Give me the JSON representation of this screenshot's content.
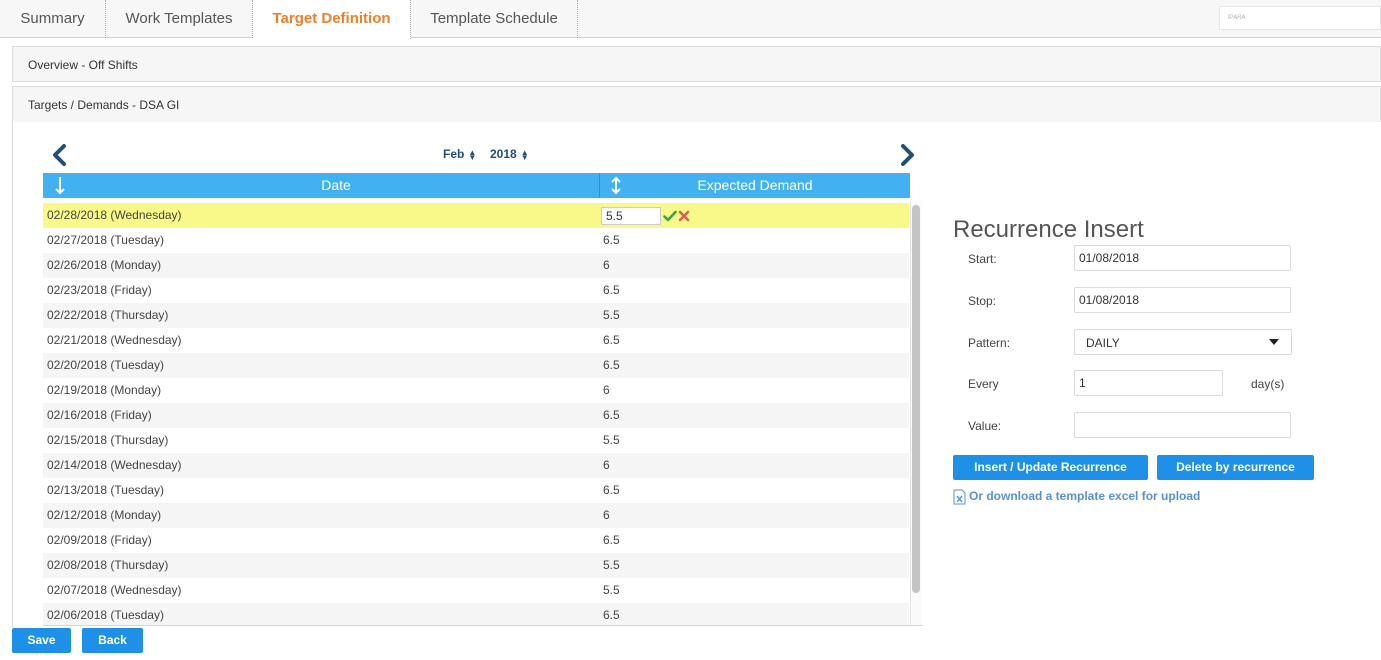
{
  "tabs": [
    {
      "label": "Summary"
    },
    {
      "label": "Work Templates"
    },
    {
      "label": "Target Definition"
    },
    {
      "label": "Template Schedule"
    }
  ],
  "tab_search": {
    "text": "ᴵᴾᴬᴿᴬ"
  },
  "panels": {
    "overview_title": "Overview - Off Shifts",
    "targets_title": "Targets / Demands - DSA GI"
  },
  "period": {
    "month": "Feb",
    "year": "2018"
  },
  "table": {
    "columns": [
      "Date",
      "Expected Demand"
    ],
    "editing_value": "5.5",
    "rows": [
      {
        "date": "02/28/2018 (Wednesday)",
        "value": "5.5"
      },
      {
        "date": "02/27/2018 (Tuesday)",
        "value": "6.5"
      },
      {
        "date": "02/26/2018 (Monday)",
        "value": "6"
      },
      {
        "date": "02/23/2018 (Friday)",
        "value": "6.5"
      },
      {
        "date": "02/22/2018 (Thursday)",
        "value": "5.5"
      },
      {
        "date": "02/21/2018 (Wednesday)",
        "value": "6.5"
      },
      {
        "date": "02/20/2018 (Tuesday)",
        "value": "6.5"
      },
      {
        "date": "02/19/2018 (Monday)",
        "value": "6"
      },
      {
        "date": "02/16/2018 (Friday)",
        "value": "6.5"
      },
      {
        "date": "02/15/2018 (Thursday)",
        "value": "5.5"
      },
      {
        "date": "02/14/2018 (Wednesday)",
        "value": "6"
      },
      {
        "date": "02/13/2018 (Tuesday)",
        "value": "6.5"
      },
      {
        "date": "02/12/2018 (Monday)",
        "value": "6"
      },
      {
        "date": "02/09/2018 (Friday)",
        "value": "6.5"
      },
      {
        "date": "02/08/2018 (Thursday)",
        "value": "5.5"
      },
      {
        "date": "02/07/2018 (Wednesday)",
        "value": "5.5"
      },
      {
        "date": "02/06/2018 (Tuesday)",
        "value": "6.5"
      }
    ]
  },
  "recurrence": {
    "title": "Recurrence Insert",
    "start_label": "Start:",
    "start_value": "01/08/2018",
    "stop_label": "Stop:",
    "stop_value": "01/08/2018",
    "pattern_label": "Pattern:",
    "pattern_value": "DAILY",
    "every_label": "Every",
    "every_value": "1",
    "every_unit": "day(s)",
    "value_label": "Value:",
    "value_value": "",
    "insert_button": "Insert / Update Recurrence",
    "delete_button": "Delete by recurrence",
    "download_link": "Or download a template excel for upload"
  },
  "footer": {
    "save": "Save",
    "back": "Back"
  },
  "colors": {
    "accent_tab": "#f07f2a",
    "table_header": "#42b1f2",
    "button": "#1e90e8",
    "edit_row": "#f8f989",
    "nav": "#224f7a"
  }
}
